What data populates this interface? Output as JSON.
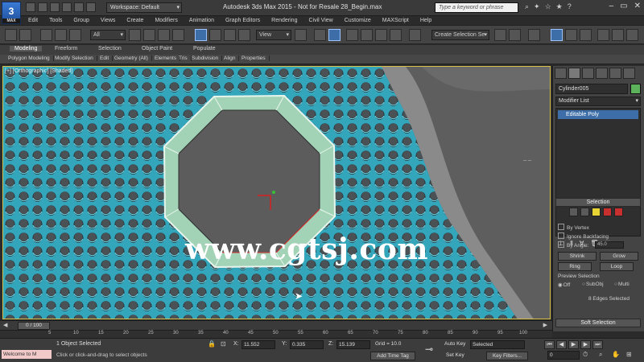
{
  "titlebar": {
    "app_logo": "3",
    "app_logo_sub": "MAX",
    "workspace": "Workspace: Default",
    "title": "Autodesk 3ds Max 2015  -  Not for Resale   28_Begin.max",
    "search_placeholder": "Type a keyword or phrase"
  },
  "menu": [
    "Edit",
    "Tools",
    "Group",
    "Views",
    "Create",
    "Modifiers",
    "Animation",
    "Graph Editors",
    "Rendering",
    "Civil View",
    "Customize",
    "MAXScript",
    "Help"
  ],
  "toolbar": {
    "filter": "All",
    "ref_coord": "View",
    "selection_set": "Create Selection Se"
  },
  "ribbon": {
    "tabs": [
      "Modeling",
      "Freeform",
      "Selection",
      "Object Paint",
      "Populate"
    ],
    "selected_tab": "Modeling",
    "sub": [
      "Polygon Modeling",
      "Modify Selection",
      "Edit",
      "Geometry (All)",
      "Elements",
      "Tris",
      "Subdivision",
      "Align",
      "Properties"
    ]
  },
  "viewport": {
    "label": "[+] [Orthographic] [Shaded]",
    "watermark": "www.cgtsj.com",
    "mark": "─  ─"
  },
  "command_panel": {
    "object_name": "Cylinder005",
    "object_color": "#5db25c",
    "modifier_list": "Modifier List",
    "stack_item": "Editable Poly",
    "selection_title": "Selection",
    "by_vertex": "By Vertex",
    "ignore_backfacing": "Ignore Backfacing",
    "by_angle": "By Angle:",
    "by_angle_value": "45.0",
    "shrink": "Shrink",
    "grow": "Grow",
    "ring": "Ring",
    "loop": "Loop",
    "preview_selection": "Preview Selection",
    "off": "Off",
    "subobj": "SubObj",
    "multi": "Multi",
    "edges_selected": "8 Edges Selected",
    "soft_selection": "Soft Selection"
  },
  "timeline": {
    "thumb": "0 / 100",
    "ticks": [
      "5",
      "10",
      "15",
      "20",
      "25",
      "30",
      "35",
      "40",
      "45",
      "50",
      "55",
      "60",
      "65",
      "70",
      "75",
      "80",
      "85",
      "90",
      "95",
      "100"
    ]
  },
  "statusbar": {
    "maxscript": "Welcome to M",
    "status1": "1 Object Selected",
    "status2": "Click or click-and-drag to select objects",
    "x_label": "X:",
    "x_value": "11.552",
    "y_label": "Y:",
    "y_value": "0.335",
    "z_label": "Z:",
    "z_value": "15.139",
    "grid": "Grid = 10.0",
    "add_time_tag": "Add Time Tag",
    "auto_key": "Auto Key",
    "selected": "Selected",
    "set_key": "Set Key",
    "key_filters": "Key Filters...",
    "frame": "0"
  }
}
